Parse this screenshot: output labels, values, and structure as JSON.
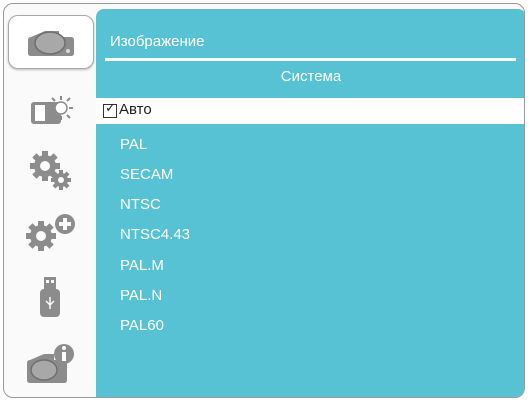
{
  "sidebar": {
    "tabs": [
      {
        "icon": "projector-icon",
        "active": true
      },
      {
        "icon": "brightness-icon",
        "active": false
      },
      {
        "icon": "settings-gear-icon",
        "active": false
      },
      {
        "icon": "advanced-settings-icon",
        "active": false
      },
      {
        "icon": "usb-icon",
        "active": false
      },
      {
        "icon": "info-icon",
        "active": false
      }
    ]
  },
  "header": {
    "title": "Изображение",
    "section": "Система"
  },
  "options": {
    "selected": "Авто",
    "items": [
      "PAL",
      "SECAM",
      "NTSC",
      "NTSC4.43",
      "PAL.M",
      "PAL.N",
      "PAL60"
    ]
  },
  "colors": {
    "accent": "#56c2d3",
    "icon_gray": "#8c8c8c"
  }
}
